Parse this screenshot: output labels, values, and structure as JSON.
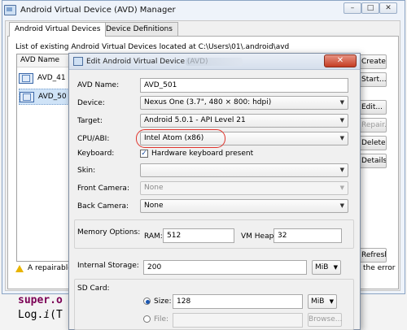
{
  "manager": {
    "title": "Android Virtual Device (AVD) Manager",
    "tabs": [
      "Android Virtual Devices",
      "Device Definitions"
    ],
    "list_caption": "List of existing Android Virtual Devices located at C:\\Users\\01\\.android\\avd",
    "column_header": "AVD Name",
    "rows": [
      "AVD_41",
      "AVD_50"
    ],
    "buttons": [
      "Create...",
      "Start...",
      "Edit...",
      "Repair...",
      "Delete...",
      "Details...",
      "Refresh"
    ],
    "warning_text": "A repairable",
    "warning_tail": "the error",
    "window_controls": [
      "minimize",
      "maximize",
      "close"
    ]
  },
  "code_snippet": {
    "line1": "super.o",
    "line2_prefix": "Log.",
    "line2_method": "i",
    "line2_suffix": "(T"
  },
  "dialog": {
    "title": "Edit Android Virtual Device (AVD)",
    "close_glyph": "✕",
    "fields": {
      "avd_name": {
        "label": "AVD Name:",
        "value": "AVD_501"
      },
      "device": {
        "label": "Device:",
        "value": "Nexus One (3.7\", 480 × 800: hdpi)"
      },
      "target": {
        "label": "Target:",
        "value": "Android 5.0.1 - API Level 21"
      },
      "cpu_abi": {
        "label": "CPU/ABI:",
        "value": "Intel Atom (x86)"
      },
      "keyboard": {
        "label": "Keyboard:",
        "checkbox_label": "Hardware keyboard present",
        "checked": true
      },
      "skin": {
        "label": "Skin:",
        "value": ""
      },
      "front_camera": {
        "label": "Front Camera:",
        "value": "None"
      },
      "back_camera": {
        "label": "Back Camera:",
        "value": "None"
      },
      "memory": {
        "label": "Memory Options:",
        "ram_label": "RAM:",
        "ram_value": "512",
        "vmheap_label": "VM Heap:",
        "vmheap_value": "32"
      },
      "internal_storage": {
        "label": "Internal Storage:",
        "value": "200",
        "unit": "MiB"
      },
      "sd_card": {
        "label": "SD Card:",
        "size_label": "Size:",
        "size_value": "128",
        "size_unit": "MiB",
        "file_label": "File:",
        "browse_label": "Browse..."
      }
    }
  },
  "colors": {
    "selection": "#cfe3f7",
    "highlight_ring": "#e0342c",
    "close_button": "#c43c23",
    "keyword": "#7b0055"
  }
}
